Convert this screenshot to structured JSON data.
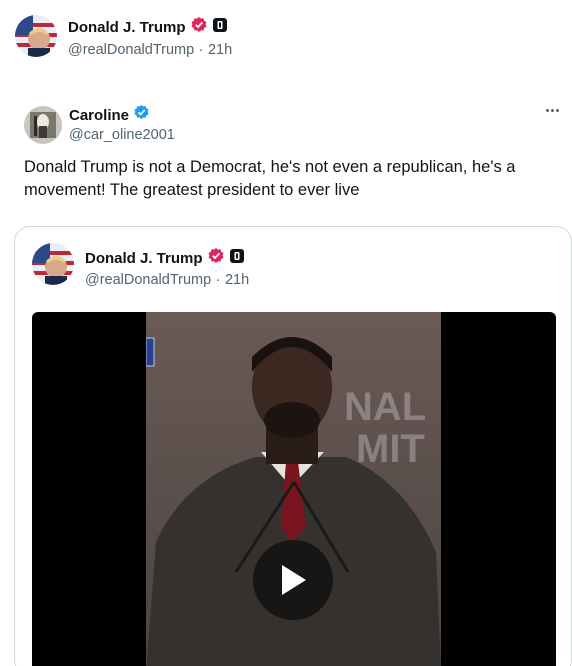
{
  "top_header": {
    "name": "Donald J. Trump",
    "handle": "@realDonaldTrump",
    "separator": "·",
    "time": "21h"
  },
  "tweet": {
    "name": "Caroline",
    "handle": "@car_oline2001",
    "text": "Donald Trump is not a Democrat, he's not even a republican, he's a movement! The greatest president to ever live"
  },
  "quote": {
    "name": "Donald J. Trump",
    "handle": "@realDonaldTrump",
    "separator": "·",
    "time": "21h",
    "video_backdrop_text": [
      "NAL",
      "MIT"
    ]
  },
  "icons": {
    "verified_pink": "verified-badge-icon",
    "verified_blue": "verified-badge-icon",
    "affiliate": "affiliate-badge-icon",
    "more": "more-icon",
    "play": "play-icon"
  },
  "colors": {
    "verified_pink": "#e0245e",
    "verified_blue": "#1d9bf0",
    "secondary_text": "#536471",
    "border": "#cfd9de"
  }
}
